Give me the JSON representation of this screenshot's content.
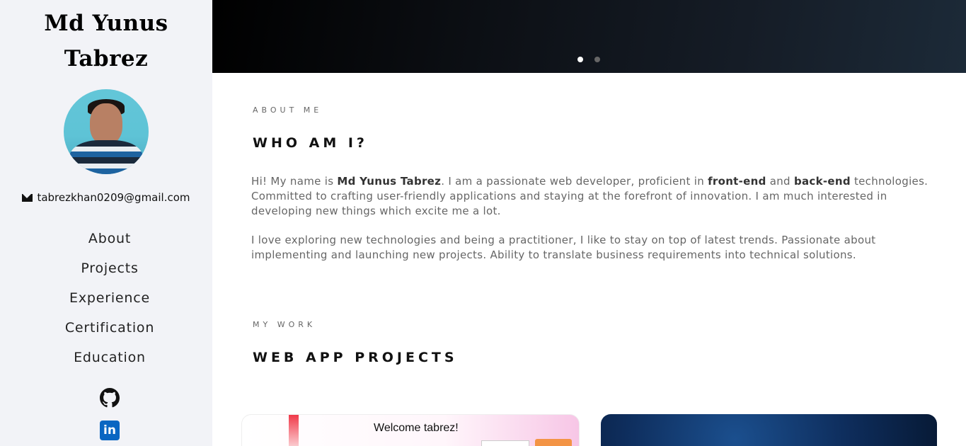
{
  "sidebar": {
    "name_line1": "Md Yunus",
    "name_line2": "Tabrez",
    "email": "tabrezkhan0209@gmail.com",
    "nav": [
      "About",
      "Projects",
      "Experience",
      "Certification",
      "Education"
    ]
  },
  "hero": {
    "slides": 2,
    "active_slide": 1
  },
  "about": {
    "eyebrow": "ABOUT ME",
    "heading": "WHO AM I?",
    "p1_a": "Hi! My name is ",
    "p1_name": "Md Yunus Tabrez",
    "p1_b": ". I am a passionate web developer, proficient in ",
    "p1_fe": "front-end",
    "p1_c": " and ",
    "p1_be": "back-end",
    "p1_d": " technologies. Committed to crafting user-friendly applications and staying at the forefront of innovation. I am much interested in developing new things which excite me a lot.",
    "p2": "I love exploring new technologies and being a practitioner, I like to stay on top of latest trends. Passionate about implementing and launching new projects. Ability to translate business requirements into technical solutions."
  },
  "work": {
    "eyebrow": "MY WORK",
    "heading": "WEB APP PROJECTS",
    "card1_title": "Welcome tabrez!"
  },
  "icons": {
    "email": "envelope-icon",
    "github": "github-icon",
    "linkedin": "linkedin-icon"
  },
  "colors": {
    "sidebar_bg": "#f2f3f7",
    "linkedin": "#0a66c2",
    "text_muted": "#666666"
  }
}
